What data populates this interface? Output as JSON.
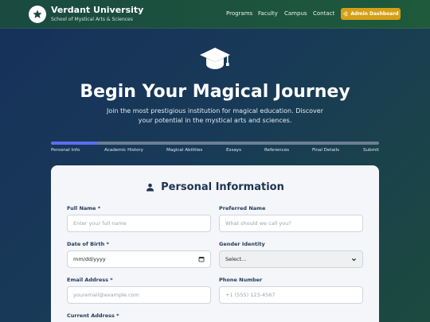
{
  "header": {
    "brand_title": "Verdant University",
    "brand_subtitle": "School of Mystical Arts & Sciences",
    "logo_icon": "star-icon",
    "nav": [
      "Programs",
      "Faculty",
      "Campus",
      "Contact"
    ],
    "admin_button": "Admin Dashboard",
    "admin_icon": "sign-in-icon"
  },
  "hero": {
    "icon": "graduation-cap-icon",
    "title": "Begin Your Magical Journey",
    "subtitle": "Join the most prestigious institution for magical education. Discover your potential in the mystical arts and sciences."
  },
  "progress": {
    "fraction_complete": 0.143,
    "steps": [
      "Personal Info",
      "Academic History",
      "Magical Abilities",
      "Essays",
      "References",
      "Final Details",
      "Submit"
    ]
  },
  "form": {
    "section_icon": "user-icon",
    "section_title": "Personal Information",
    "full_name": {
      "label": "Full Name *",
      "placeholder": "Enter your full name"
    },
    "preferred_name": {
      "label": "Preferred Name",
      "placeholder": "What should we call you?"
    },
    "dob": {
      "label": "Date of Birth *",
      "value": "mm/dd/yyyy"
    },
    "gender": {
      "label": "Gender Identity",
      "value": "Select..."
    },
    "email": {
      "label": "Email Address *",
      "placeholder": "youremail@example.com"
    },
    "phone": {
      "label": "Phone Number",
      "placeholder": "+1 (555) 123-4567"
    },
    "address": {
      "label": "Current Address *"
    }
  },
  "colors": {
    "accent": "#d4a017",
    "progress": "#5b6ef0",
    "header": "#1f5a3c"
  }
}
